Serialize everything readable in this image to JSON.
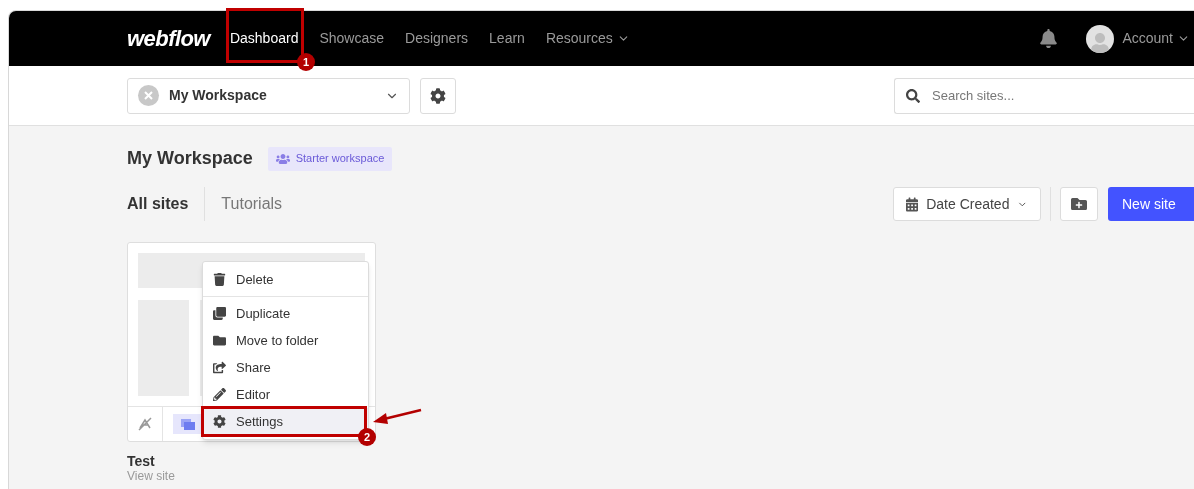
{
  "nav": {
    "logo": "webflow",
    "links": [
      {
        "label": "Dashboard",
        "selected": true
      },
      {
        "label": "Showcase",
        "selected": false
      },
      {
        "label": "Designers",
        "selected": false
      },
      {
        "label": "Learn",
        "selected": false
      },
      {
        "label": "Resources",
        "selected": false,
        "dropdown": true
      }
    ],
    "account": "Account"
  },
  "toolbar": {
    "workspace": "My Workspace",
    "search": {
      "placeholder": "Search sites..."
    }
  },
  "workspace": {
    "title": "My Workspace",
    "badge": "Starter workspace"
  },
  "tabs": [
    {
      "label": "All sites",
      "selected": true
    },
    {
      "label": "Tutorials",
      "selected": false
    }
  ],
  "sort": {
    "label": "Date Created"
  },
  "new_site": "New site",
  "site": {
    "name": "Test",
    "link": "View site"
  },
  "menu": [
    {
      "kind": "delete",
      "label": "Delete",
      "highlighted": false
    },
    {
      "kind": "duplicate",
      "label": "Duplicate",
      "highlighted": false
    },
    {
      "kind": "move",
      "label": "Move to folder",
      "highlighted": false
    },
    {
      "kind": "share",
      "label": "Share",
      "highlighted": false
    },
    {
      "kind": "editor",
      "label": "Editor",
      "highlighted": false
    },
    {
      "kind": "settings",
      "label": "Settings",
      "highlighted": true
    }
  ],
  "annotations": [
    {
      "number": "1"
    },
    {
      "number": "2"
    }
  ]
}
